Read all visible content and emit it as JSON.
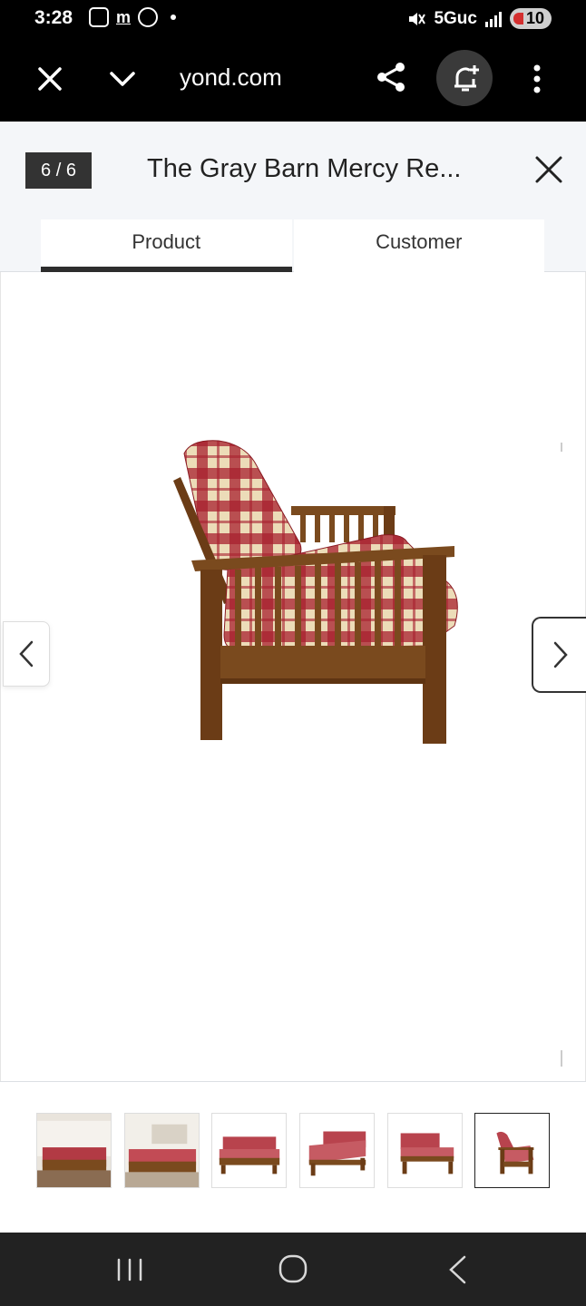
{
  "status_bar": {
    "time": "3:28",
    "network": "5Guc",
    "battery": "10"
  },
  "browser": {
    "url": "yond.com"
  },
  "modal": {
    "counter": "6 / 6",
    "title": "The Gray Barn Mercy Re...",
    "tabs": [
      {
        "label": "Product",
        "active": true
      },
      {
        "label": "Customer",
        "active": false
      }
    ]
  },
  "thumbnails": {
    "count": 6,
    "selected_index": 5
  },
  "colors": {
    "wood": "#7a4a1e",
    "plaid_red": "#a8202e",
    "plaid_cream": "#ecdcb8",
    "counter_bg": "#333333",
    "tab_indicator": "#2d2d2d"
  },
  "icons": [
    "close-icon",
    "chevron-down-icon",
    "share-icon",
    "bell-add-icon",
    "more-vert-icon",
    "chevron-left-icon",
    "chevron-right-icon",
    "recent-apps-icon",
    "home-icon",
    "back-icon"
  ]
}
